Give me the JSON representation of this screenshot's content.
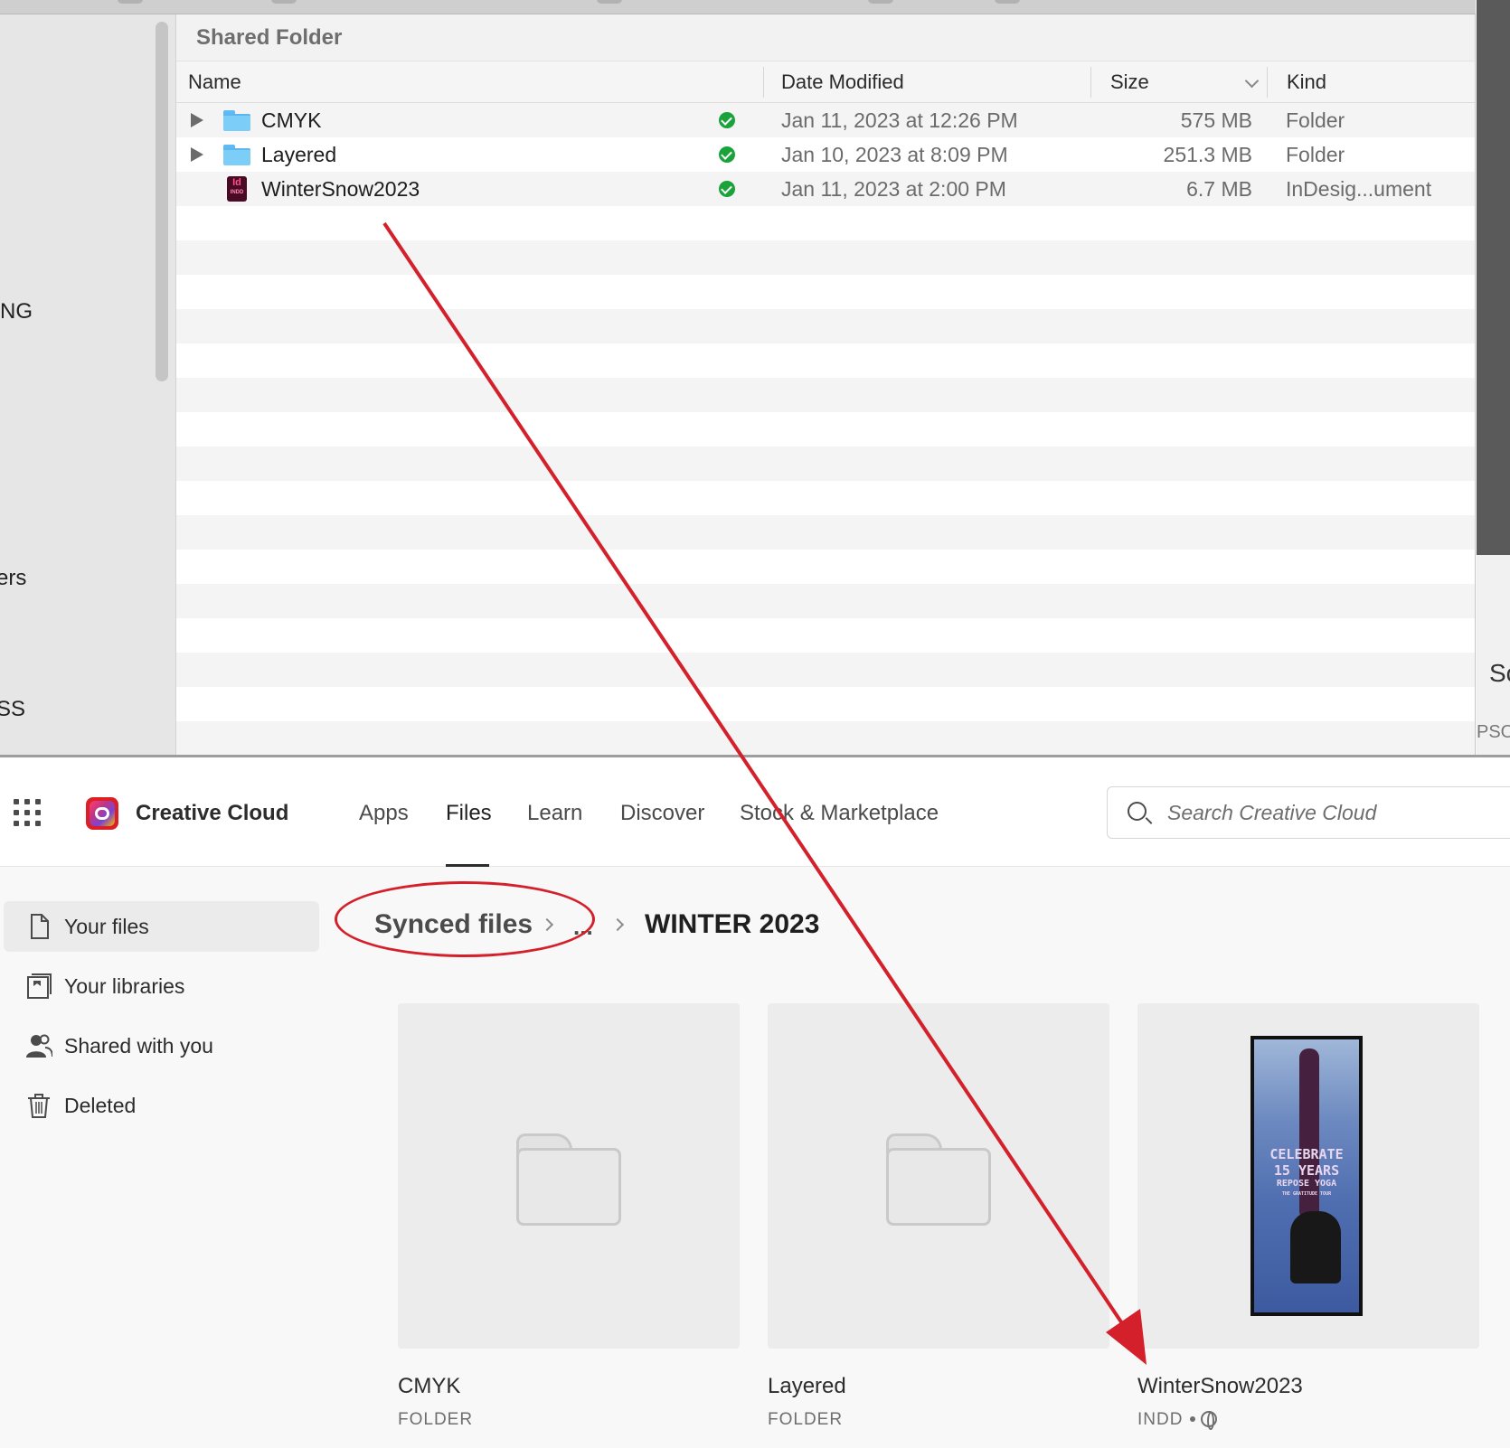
{
  "finder": {
    "title": "Shared Folder",
    "sidebar_fragments": [
      "NG",
      "ers",
      "SS"
    ],
    "columns": {
      "name": "Name",
      "date": "Date Modified",
      "size": "Size",
      "kind": "Kind"
    },
    "rows": [
      {
        "name": "CMYK",
        "type": "folder",
        "date": "Jan 11, 2023 at 12:26 PM",
        "size": "575 MB",
        "kind": "Folder"
      },
      {
        "name": "Layered",
        "type": "folder",
        "date": "Jan 10, 2023 at 8:09 PM",
        "size": "251.3 MB",
        "kind": "Folder"
      },
      {
        "name": "WinterSnow2023",
        "type": "indd",
        "date": "Jan 11, 2023 at 2:00 PM",
        "size": "6.7 MB",
        "kind": "InDesig...ument"
      }
    ],
    "indd_icon_label": "Id",
    "indd_icon_sub": "INDD"
  },
  "background_window": {
    "fragment_top": "Sc",
    "fragment_bottom": "PSO"
  },
  "cc": {
    "brand": "Creative Cloud",
    "nav": [
      "Apps",
      "Files",
      "Learn",
      "Discover",
      "Stock & Marketplace"
    ],
    "active_nav": "Files",
    "search_placeholder": "Search Creative Cloud",
    "sidebar": [
      "Your files",
      "Your libraries",
      "Shared with you",
      "Deleted"
    ],
    "breadcrumb": {
      "root": "Synced files",
      "ellipsis": "...",
      "current": "WINTER 2023"
    },
    "files": [
      {
        "name": "CMYK",
        "kind": "FOLDER"
      },
      {
        "name": "Layered",
        "kind": "FOLDER"
      },
      {
        "name": "WinterSnow2023",
        "kind": "INDD"
      }
    ],
    "poster_text": [
      "CELEBRATE",
      "15 YEARS",
      "REPOSE YOGA",
      "THE GRATITUDE TOUR"
    ]
  },
  "colors": {
    "annotation": "#d4202a",
    "sync_check": "#19a33a",
    "folder_blue": "#7dcdf9"
  }
}
